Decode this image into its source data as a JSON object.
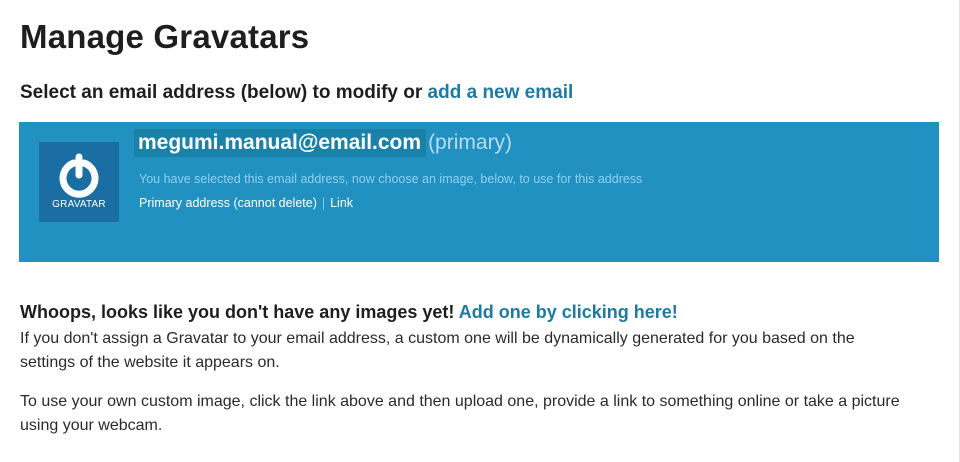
{
  "page": {
    "title": "Manage Gravatars"
  },
  "instruction": {
    "text": "Select an email address (below) to modify or ",
    "link": "add a new email"
  },
  "selected_email": {
    "logo_text": "GRAVATAR",
    "address": "megumi.manual@email.com",
    "tag": "(primary)",
    "note": "You have selected this email address, now choose an image, below, to use for this address",
    "primary_label": "Primary address (cannot delete)",
    "separator": "|",
    "link_label": "Link"
  },
  "no_images": {
    "heading": "Whoops, looks like you don't have any images yet! ",
    "heading_link": "Add one by clicking here!",
    "para1": "If you don't assign a Gravatar to your email address, a custom one will be dynamically generated for you based on the settings of the website it appears on.",
    "para2": "To use your own custom image, click the link above and then upload one, provide a link to something online or take a picture using your webcam."
  },
  "colors": {
    "panel_bg": "#2191c2",
    "logo_bg": "#1a6ea3",
    "link": "#1d7aa3",
    "email_highlight": "#1a82a9"
  }
}
